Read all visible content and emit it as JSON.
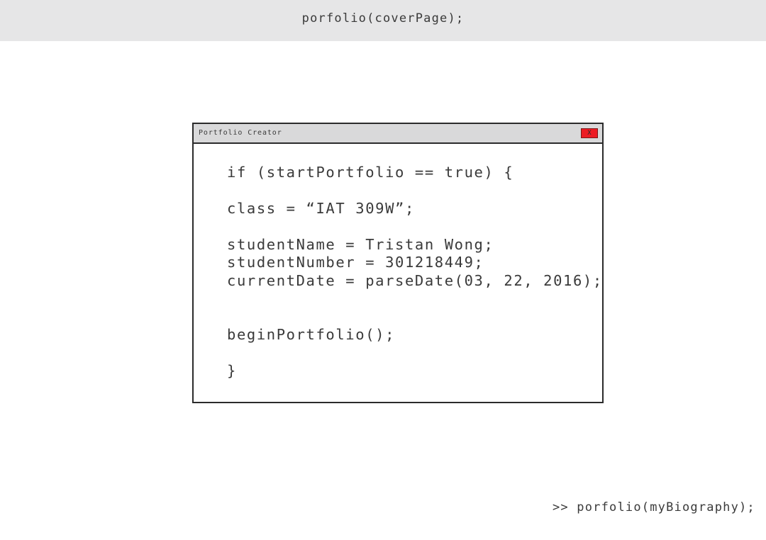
{
  "header": {
    "title": "porfolio(coverPage);"
  },
  "window": {
    "title": "Portfolio Creator",
    "close_label": "X",
    "code_lines": [
      "if (startPortfolio == true) {",
      "class = “IAT 309W”;",
      "studentName = Tristan Wong;",
      "studentNumber = 301218449;",
      "currentDate = parseDate(03, 22, 2016);",
      "beginPortfolio();",
      "}"
    ]
  },
  "footer": {
    "next_link": ">> porfolio(myBiography);"
  },
  "colors": {
    "header_bg": "#e6e6e7",
    "titlebar_bg": "#d9d9da",
    "close_button": "#ed1c24",
    "border": "#2b2b2b"
  }
}
